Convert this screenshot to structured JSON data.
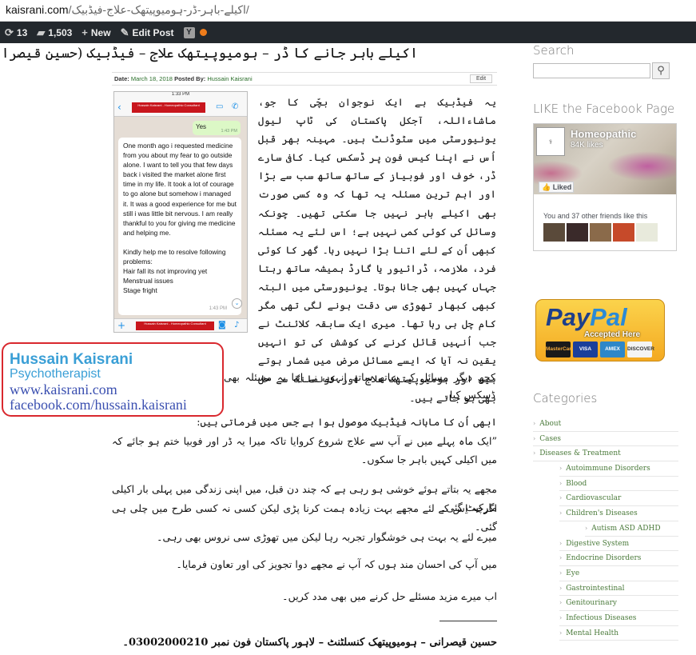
{
  "browser": {
    "domain": "kaisrani.com",
    "path": "/اکیلے-باہر-ڈر-ہومیوپیتھک-علاج-فیڈبیک/"
  },
  "adminbar": {
    "sync_count": "13",
    "comments_count": "1,503",
    "new_label": "New",
    "edit_label": "Edit Post"
  },
  "post": {
    "title": "اکیلے باہر جانے کا ڈر – ہومیوپیتھک علاج – فیڈبیک (حسین قیصرانی)۔",
    "date_label": "Date:",
    "date": "March 18, 2018",
    "posted_by_label": "Posted By:",
    "author": "Hussain Kaisrani",
    "edit": "Edit",
    "intro": "یہ فیڈبیک ہے ایک نوجوان بچّی کا جو، ماشاءاللہ، آجکل پاکستان کی ٹاپ لیول یونیورسٹی میں سٹوڈنٹ ہیں۔ مہینہ بھر قبل اُس نے اپنا کیس فون پر ڈسکس کیا۔ کافی سارے ڈر، خوف اور فوبیاز کے ساتھ ساتھ سب سے بڑا اور اہم ترین مسئلہ یہ تھا کہ وہ کسی صورت بھی اکیلے باہر نہیں جا سکتی تھیں۔ چونکہ وسائل کی کوئی کمی نہیں ہے؛ اس لئے یہ مسئلہ کبھی اُن کے لئے اتنا بڑا نہیں رہا۔ گھر کا کوئی فرد، ملازمہ، ڈرائیور یا گارڈ ہمیشہ ساتھ رہتا جہاں کہیں بھی جانا ہوتا۔ یونیورسٹی میں البتہ کبھی کبھار تھوڑی سی دقت ہونے لگی تھی مگر کام چل ہی رہا تھا۔ میری ایک سابقہ کلائنٹ نے جب اُنہیں قائل کرنے کی کوشش کی تو انہیں یقین نہ آیا کہ ایسے مسائل مرض میں شمار ہوتے ہیں اور ہومیوپیتھک علاج اور کونسلنگ سے حل بھی ہو جاتے ہیں۔",
    "intro_cont": "کچھ دیگر مسائل کے ساتھ ساتھ اِنہوں نے اپنا یہ مسئلہ بھی ڈسکس کیا۔",
    "p1": "ابھی اُن کا ماہانہ فیڈبیک موصول ہوا ہے جس میں فرماتی ہیں:",
    "p2": "”ایک ماہ پہلے میں نے آپ سے علاج شروع کروایا تاکہ میرا یہ ڈر اور فوبیا ختم ہو جائے کہ میں اکیلی کہیں باہر جا سکوں۔",
    "p3": "مجھے یہ بتاتے ہوئے خوشی ہو رہی ہے کہ چند دن قبل، میں اپنی زندگی میں پہلی بار اکیلی مارکیٹ گئی۔",
    "p4": "اگرچہ اِس کے لئے مجھے بہت زیادہ ہمت کرنا پڑی لیکن کسی نہ کسی طرح میں چلی ہی گئی۔",
    "p5": "میرے لئے یہ بہت ہی خوشگوار تجربہ رہا لیکن میں تھوڑی سی نروس بھی رہی۔",
    "p6": "میں آپ کی احسان مند ہوں کہ آپ نے مجھے دوا تجویز کی اور تعاون فرمایا۔",
    "p7": "اب میرے مزید مسئلے حل کرنے میں بھی مدد کریں۔",
    "signature": "حسین قیصرانی – ہومیوپیتھک کنسلٹنٹ – لاہور پاکستان فون نمبر 03002000210۔"
  },
  "phone": {
    "status_time": "1:33 PM",
    "banner_text": "Hussain Kaisrani - Homeopathic Consultant",
    "yes_text": "Yes",
    "yes_time": "1:43 PM",
    "msg_p1": "One month ago i requested medicine from you about my fear to go outside alone. I want to tell you that few days back i visited the market alone first time in my life. It took a lot of courage to go alone but somehow i managed it. It was a good experience for me but still i was little bit nervous. I am really thankful to you for giving me medicine and helping me.",
    "msg_p2": "Kindly help me to resolve following problems:",
    "msg_p3": "Hair fall its not improving yet",
    "msg_p4": "Menstrual issues",
    "msg_p5": "Stage fright",
    "msg_time": "1:43 PM"
  },
  "card": {
    "name": "Hussain Kaisrani",
    "role": "Psychotherapist",
    "web": "www.kaisrani.com",
    "fb": "facebook.com/hussain.kaisrani"
  },
  "sidebar": {
    "search_heading": "Search",
    "fb_heading": "LIKE the Facebook Page",
    "fb_page_name": "Homeopathic",
    "fb_likes": "84K likes",
    "fb_liked": "Liked",
    "fb_friends": "You and 37 other friends like this",
    "paypal_pay": "Pay",
    "paypal_pal": "Pal",
    "paypal_accepted": "Accepted Here",
    "paypal_cards": [
      "MasterCard",
      "VISA",
      "AMEX",
      "DISCOVER"
    ],
    "categories_heading": "Categories",
    "categories": [
      {
        "label": "About",
        "level": 1
      },
      {
        "label": "Cases",
        "level": 1
      },
      {
        "label": "Diseases & Treatment",
        "level": 1
      },
      {
        "label": "Autoimmune Disorders",
        "level": 2
      },
      {
        "label": "Blood",
        "level": 2
      },
      {
        "label": "Cardiovascular",
        "level": 2
      },
      {
        "label": "Children's Diseases",
        "level": 2
      },
      {
        "label": "Autism ASD ADHD",
        "level": 3
      },
      {
        "label": "Digestive System",
        "level": 2
      },
      {
        "label": "Endocrine Disorders",
        "level": 2
      },
      {
        "label": "Eye",
        "level": 2
      },
      {
        "label": "Gastrointestinal",
        "level": 2
      },
      {
        "label": "Genitourinary",
        "level": 2
      },
      {
        "label": "Infectious Diseases",
        "level": 2
      },
      {
        "label": "Mental Health",
        "level": 2
      }
    ]
  },
  "colors": {
    "link_green": "#4a7a3a",
    "card_blue": "#3a9fd6",
    "card_border": "#d9282e",
    "adminbar": "#23282d"
  }
}
